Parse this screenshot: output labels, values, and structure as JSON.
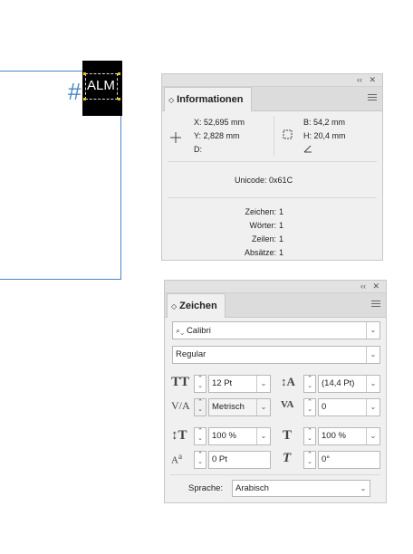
{
  "canvas": {
    "hash_glyph": "#",
    "selected_text": "ALM"
  },
  "info_panel": {
    "collapse": "‹‹",
    "close": "✕",
    "title": "Informationen",
    "x_label": "X:",
    "x_value": "52,695 mm",
    "y_label": "Y:",
    "y_value": "2,828 mm",
    "d_label": "D:",
    "w_label": "B:",
    "w_value": "54,2 mm",
    "h_label": "H:",
    "h_value": "20,4 mm",
    "unicode_label": "Unicode:",
    "unicode_value": "0x61C",
    "stats": [
      {
        "label": "Zeichen:",
        "value": "1"
      },
      {
        "label": "Wörter:",
        "value": "1"
      },
      {
        "label": "Zeilen:",
        "value": "1"
      },
      {
        "label": "Absätze:",
        "value": "1"
      }
    ]
  },
  "char_panel": {
    "collapse": "‹‹",
    "close": "✕",
    "title": "Zeichen",
    "font_family": "Calibri",
    "font_style": "Regular",
    "font_size": "12 Pt",
    "leading": "(14,4 Pt)",
    "kerning": "Metrisch",
    "tracking": "0",
    "vertical_scale": "100 %",
    "horizontal_scale": "100 %",
    "baseline_shift": "0 Pt",
    "skew": "0°",
    "language_label": "Sprache:",
    "language_value": "Arabisch"
  }
}
